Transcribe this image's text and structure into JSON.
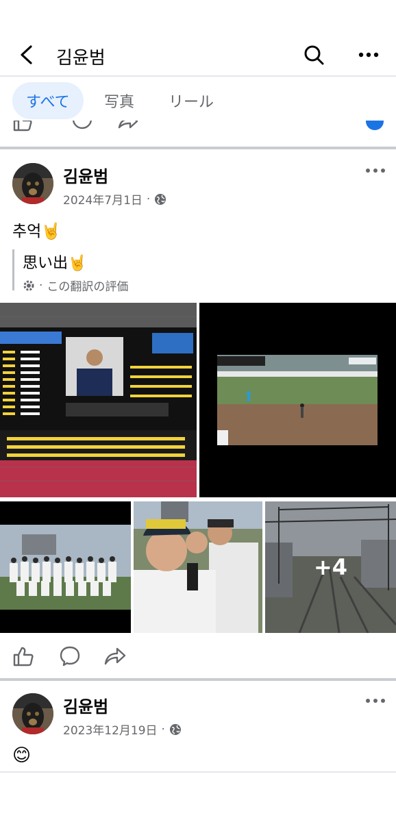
{
  "header": {
    "title": "김윤범"
  },
  "tabs": [
    {
      "label": "すべて"
    },
    {
      "label": "写真"
    },
    {
      "label": "リール"
    }
  ],
  "posts": [
    {
      "author": "김윤범",
      "date": "2024年7月1日",
      "text": "추억🤘",
      "translation": {
        "text": "思い出🤘",
        "rate_label": "この翻訳の評価"
      },
      "photos": [
        {
          "description_icon": "scoreboard-photo"
        },
        {
          "description_icon": "baseball-broadcast-photo"
        },
        {
          "description_icon": "team-photo"
        },
        {
          "description_icon": "selfie-photo"
        },
        {
          "description_icon": "railway-photo",
          "more_count": "+4"
        }
      ]
    },
    {
      "author": "김윤범",
      "date": "2023年12月19日",
      "text": "😊"
    }
  ],
  "colors": {
    "accent": "#1b74e4",
    "secondary_text": "#65676b"
  }
}
